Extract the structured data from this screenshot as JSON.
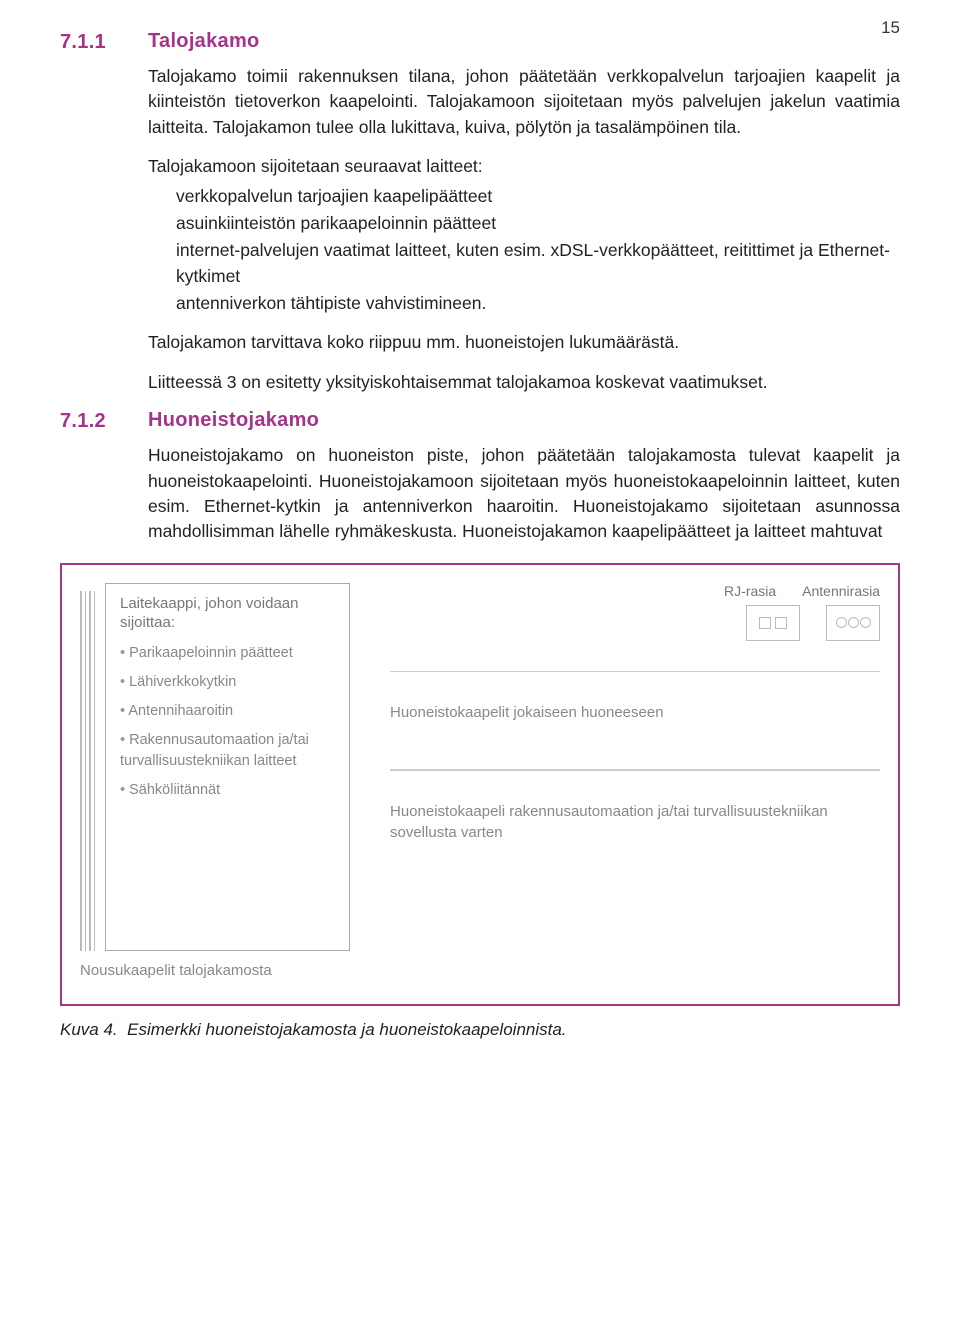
{
  "page_number": "15",
  "sections": [
    {
      "num": "7.1.1",
      "title": "Talojakamo",
      "paras": [
        "Talojakamo toimii rakennuksen tilana, johon päätetään verkkopalvelun tarjoajien kaapelit ja kiinteistön tietoverkon kaapelointi. Talojakamoon sijoitetaan myös palvelujen jakelun vaatimia laitteita. Talojakamon tulee olla lukittava, kuiva, pölytön ja tasalämpöinen tila."
      ],
      "list_intro": "Talojakamoon sijoitetaan seuraavat laitteet:",
      "list": [
        "verkkopalvelun tarjoajien kaapelipäätteet",
        "asuinkiinteistön parikaapeloinnin päätteet",
        "internet-palvelujen vaatimat laitteet, kuten esim. xDSL-verkkopäätteet, reitittimet ja Ethernet-kytkimet",
        "antenniverkon tähtipiste vahvistimineen."
      ],
      "after_paras": [
        "Talojakamon tarvittava koko riippuu mm. huoneistojen lukumäärästä.",
        "Liitteessä 3 on esitetty yksityiskohtaisemmat talojakamoa koskevat vaatimukset."
      ]
    },
    {
      "num": "7.1.2",
      "title": "Huoneistojakamo",
      "paras": [
        "Huoneistojakamo on huoneiston piste, johon päätetään talojakamosta tulevat kaapelit ja huoneistokaapelointi. Huoneistojakamoon sijoitetaan myös huoneistokaapeloinnin laitteet, kuten esim. Ethernet-kytkin ja antenniverkon haaroitin. Huoneistojakamo sijoitetaan asunnossa mahdollisimman lähelle ryhmäkeskusta. Huoneistojakamon kaapelipäätteet ja laitteet mahtuvat"
      ]
    }
  ],
  "figure": {
    "cabinet_title": "Laitekaappi, johon voidaan sijoittaa:",
    "cabinet_items": [
      "Parikaapeloinnin päätteet",
      "Lähiverkkokytkin",
      "Antennihaaroitin",
      "Rakennusautomaation ja/tai turvallisuustekniikan laitteet",
      "Sähköliitännät"
    ],
    "outlet_left": "RJ-rasia",
    "outlet_right": "Antennirasia",
    "cable_room": "Huoneistokaapelit jokaiseen huoneeseen",
    "cable_auto": "Huoneistokaapeli rakennusautomaation ja/tai turvallisuustekniikan sovellusta varten",
    "riser_label": "Nousukaapelit talojakamosta"
  },
  "caption": {
    "num": "Kuva 4.",
    "text": "Esimerkki huoneistojakamosta ja huoneistokaapeloinnista."
  }
}
